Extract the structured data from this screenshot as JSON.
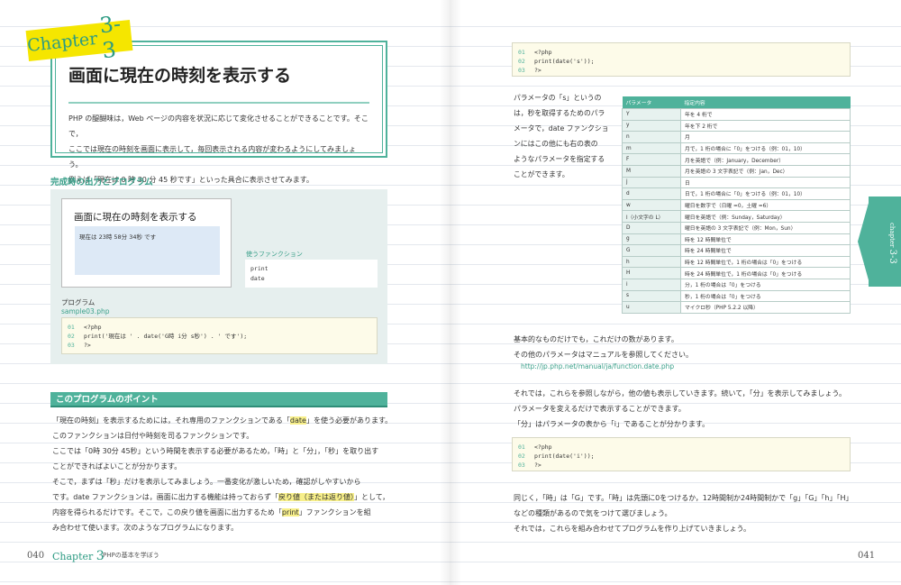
{
  "left_page": {
    "chapter_banner": {
      "word": "Chapter",
      "num": "3-3"
    },
    "title": "画面に現在の時刻を表示する",
    "intro": [
      "PHP の醍醐味は，Web ページの内容を状況に応じて変化させることができることです。そこで，",
      "ここでは現在の時刻を画面に表示して，毎回表示される内容が変わるようにしてみましょう。",
      "例えば「現在は 0 時 30 分 45 秒です」といった具合に表示させてみます。"
    ],
    "output_section_label": "完成時の出力とプログラム",
    "output_window": {
      "title": "画面に現在の時刻を表示する",
      "body": "現在は 23時 58分 34秒 です"
    },
    "func_label": "使うファンクション",
    "funcs": [
      "print",
      "date"
    ],
    "program_label": "プログラム",
    "program_file": "sample03.php",
    "code": [
      {
        "ln": "01",
        "text": "<?php"
      },
      {
        "ln": "02",
        "text": "print('現在は ' . date('G時 i分 s秒') . ' です');"
      },
      {
        "ln": "03",
        "text": "?>"
      }
    ],
    "point_heading": "このプログラムのポイント",
    "body_lines": [
      {
        "pre": "「現在の時刻」を表示するためには，それ専用のファンクションである「",
        "hl": "date",
        "post": "」を使う必要があります。"
      },
      {
        "pre": "このファンクションは日付や時刻を司るファンクションです。",
        "hl": "",
        "post": ""
      },
      {
        "pre": "ここでは「0時 30分 45秒」という時間を表示する必要があるため，「時」と「分」，「秒」を取り出す",
        "hl": "",
        "post": ""
      },
      {
        "pre": "ことができればよいことが分かります。",
        "hl": "",
        "post": ""
      },
      {
        "pre": "そこで，まずは「秒」だけを表示してみましょう。一番変化が激しいため，確認がしやすいから",
        "hl": "",
        "post": ""
      },
      {
        "pre": "です。date ファンクションは，画面に出力する機能は持っておらず「",
        "hl": "戻り値（または返り値）",
        "post": "」として，"
      },
      {
        "pre": "内容を得られるだけです。そこで，この戻り値を画面に出力するため「",
        "hl": "print",
        "post": "」ファンクションを組"
      },
      {
        "pre": "み合わせて使います。次のようなプログラムになります。",
        "hl": "",
        "post": ""
      }
    ],
    "footer": {
      "page": "040",
      "chapter_word": "Chapter",
      "chapter_num": "3",
      "subtitle": "PHPの基本を学ぼう"
    }
  },
  "right_page": {
    "code1": [
      {
        "ln": "01",
        "text": "<?php"
      },
      {
        "ln": "02",
        "text": "print(date('s'));"
      },
      {
        "ln": "03",
        "text": "?>"
      }
    ],
    "param_text": [
      "パラメータの「s」というの",
      "は，秒を取得するためのパラ",
      "メータで，date ファンクショ",
      "ンにはこの他にも右の表の",
      "ようなパラメータを指定する",
      "ことができます。"
    ],
    "table": {
      "headers": [
        "パラメータ",
        "指定内容"
      ],
      "rows": [
        [
          "Y",
          "年を 4 桁で"
        ],
        [
          "y",
          "年を下 2 桁で"
        ],
        [
          "n",
          "月"
        ],
        [
          "m",
          "月で，1 桁の場合に「0」をつける（例：01，10）"
        ],
        [
          "F",
          "月を英語で（例：January，December）"
        ],
        [
          "M",
          "月を英語の 3 文字表記で（例：Jan，Dec）"
        ],
        [
          "j",
          "日"
        ],
        [
          "d",
          "日で，1 桁の場合に「0」をつける（例：01，10）"
        ],
        [
          "w",
          "曜日を数字で（日曜 =0，土曜 =6）"
        ],
        [
          "l（小文字の L）",
          "曜日を英語で（例：Sunday，Saturday）"
        ],
        [
          "D",
          "曜日を英語の 3 文字表記で（例：Mon，Sun）"
        ],
        [
          "g",
          "時を 12 時間単位で"
        ],
        [
          "G",
          "時を 24 時間単位で"
        ],
        [
          "h",
          "時を 12 時間単位で，1 桁の場合は「0」をつける"
        ],
        [
          "H",
          "時を 24 時間単位で，1 桁の場合は「0」をつける"
        ],
        [
          "i",
          "分，1 桁の場合は「0」をつける"
        ],
        [
          "s",
          "秒，1 桁の場合は「0」をつける"
        ],
        [
          "u",
          "マイクロ秒（PHP 5.2.2 以降）"
        ]
      ]
    },
    "basic_text": [
      "基本的なものだけでも，これだけの数があります。",
      "その他のパラメータはマニュアルを参照してください。"
    ],
    "url": "http://jp.php.net/manual/ja/function.date.php",
    "mid_text": [
      "それでは，これらを参照しながら，他の値も表示していきます。続いて，「分」を表示してみましょう。",
      "パラメータを変えるだけで表示することができます。",
      "「分」はパラメータの表から「i」であることが分かります。"
    ],
    "code2": [
      {
        "ln": "01",
        "text": "<?php"
      },
      {
        "ln": "02",
        "text": "print(date('i'));"
      },
      {
        "ln": "03",
        "text": "?>"
      }
    ],
    "end_text": [
      "同じく，「時」は「G」です。「時」は先頭に0をつけるか，12時間制か24時間制かで「g」「G」「h」「H」",
      "などの種類があるので気をつけて選びましょう。",
      "それでは，これらを組み合わせてプログラムを作り上げていきましょう。"
    ],
    "side_tab": {
      "word": "chapter",
      "num": "3-3"
    },
    "footer_page": "041"
  }
}
